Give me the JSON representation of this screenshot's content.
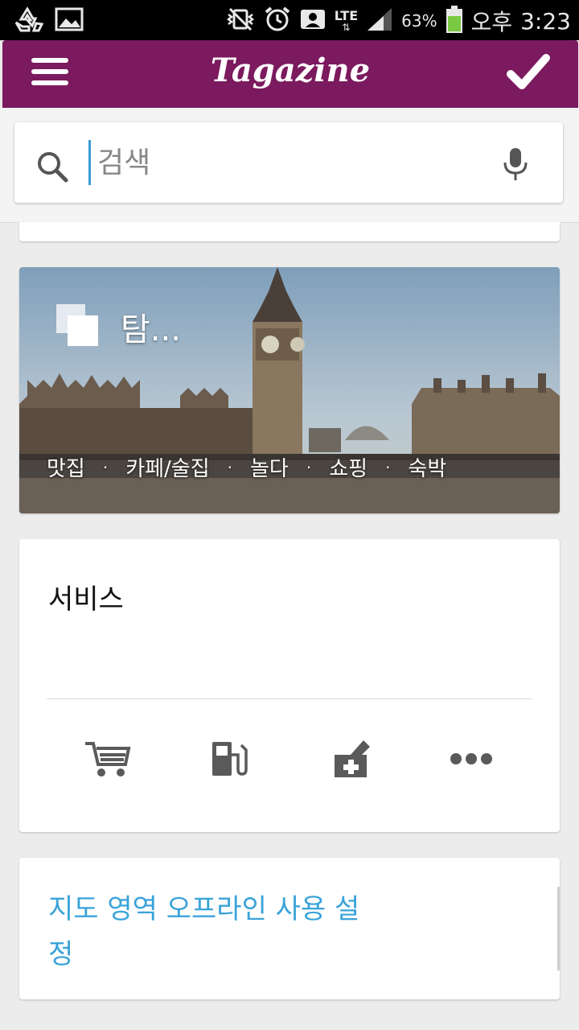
{
  "status_bar": {
    "network": "LTE",
    "battery_percent": "63%",
    "time_period": "오후",
    "time": "3:23"
  },
  "app_bar": {
    "title": "Tagazine",
    "menu_icon": "hamburger-menu-icon",
    "confirm_icon": "checkmark-icon",
    "color": "#7b1a5e"
  },
  "search": {
    "placeholder": "검색",
    "value": ""
  },
  "explore_card": {
    "title": "탐...",
    "links": [
      "맛집",
      "카페/술집",
      "놀다",
      "쇼핑",
      "숙박"
    ],
    "separator": "·"
  },
  "services_card": {
    "title": "서비스",
    "icons": [
      "shopping-cart-icon",
      "gas-station-icon",
      "pharmacy-icon",
      "more-dots-icon"
    ]
  },
  "offline_card": {
    "link_text": "지도 영역 오프라인 사용 설정",
    "link_color": "#3aa3d9"
  }
}
